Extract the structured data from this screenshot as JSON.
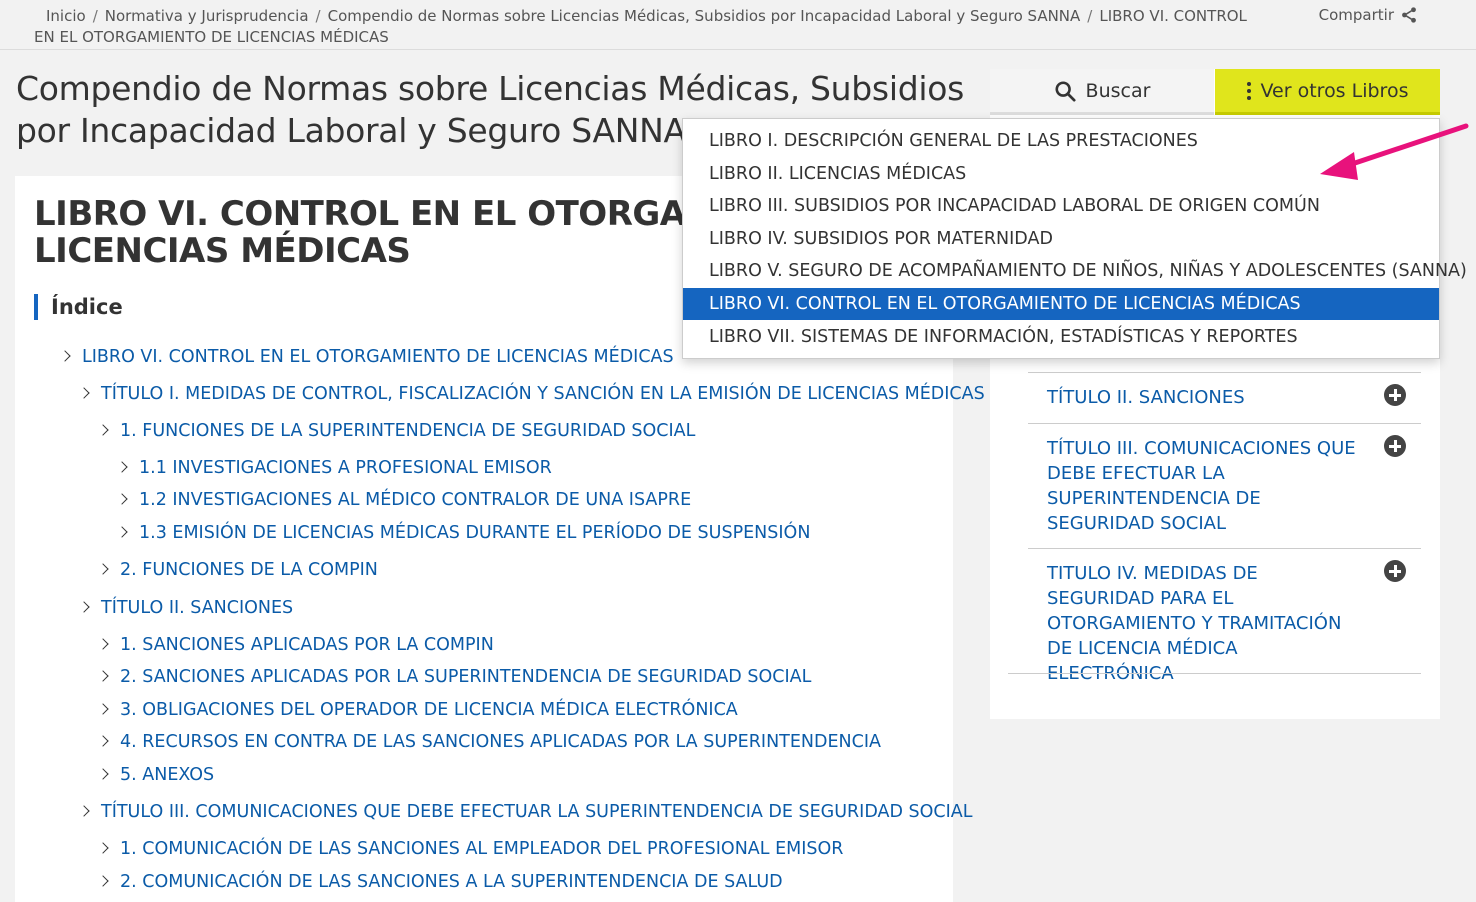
{
  "breadcrumb": {
    "items": [
      "Inicio",
      "Normativa y Jurisprudencia",
      "Compendio de Normas sobre Licencias Médicas, Subsidios por Incapacidad Laboral y Seguro SANNA",
      "LIBRO VI. CONTROL EN EL OTORGAMIENTO DE LICENCIAS MÉDICAS"
    ],
    "separator": "/"
  },
  "share": {
    "label": "Compartir",
    "icon": "share-icon"
  },
  "page_title": "Compendio de Normas sobre Licencias Médicas, Subsidios por Incapacidad Laboral y Seguro SANNA",
  "book": {
    "heading": "LIBRO VI. CONTROL EN EL OTORGAMIENTO DE LICENCIAS MÉDICAS",
    "index_label": "Índice"
  },
  "toc": [
    {
      "level": 0,
      "label": "LIBRO VI. CONTROL EN EL OTORGAMIENTO DE LICENCIAS MÉDICAS"
    },
    {
      "level": 1,
      "label": "TÍTULO I. MEDIDAS DE CONTROL, FISCALIZACIÓN Y SANCIÓN EN LA EMISIÓN DE LICENCIAS MÉDICAS"
    },
    {
      "level": 2,
      "label": "1. FUNCIONES DE LA SUPERINTENDENCIA DE SEGURIDAD SOCIAL"
    },
    {
      "level": 3,
      "label": "1.1 INVESTIGACIONES A PROFESIONAL EMISOR"
    },
    {
      "level": 3,
      "label": "1.2 INVESTIGACIONES AL MÉDICO CONTRALOR DE UNA ISAPRE"
    },
    {
      "level": 3,
      "label": "1.3 EMISIÓN DE LICENCIAS MÉDICAS DURANTE EL PERÍODO DE SUSPENSIÓN"
    },
    {
      "level": 2,
      "label": "2. FUNCIONES DE LA COMPIN"
    },
    {
      "level": 1,
      "label": "TÍTULO II. SANCIONES"
    },
    {
      "level": 2,
      "label": "1. SANCIONES APLICADAS POR LA COMPIN"
    },
    {
      "level": 2,
      "label": "2. SANCIONES APLICADAS POR LA SUPERINTENDENCIA DE SEGURIDAD SOCIAL"
    },
    {
      "level": 2,
      "label": "3. OBLIGACIONES DEL OPERADOR DE LICENCIA MÉDICA ELECTRÓNICA"
    },
    {
      "level": 2,
      "label": "4. RECURSOS EN CONTRA DE LAS SANCIONES APLICADAS POR LA SUPERINTENDENCIA"
    },
    {
      "level": 2,
      "label": "5. ANEXOS"
    },
    {
      "level": 1,
      "label": "TÍTULO III. COMUNICACIONES QUE DEBE EFECTUAR LA SUPERINTENDENCIA DE SEGURIDAD SOCIAL"
    },
    {
      "level": 2,
      "label": "1. COMUNICACIÓN DE LAS SANCIONES AL EMPLEADOR DEL PROFESIONAL EMISOR"
    },
    {
      "level": 2,
      "label": "2. COMUNICACIÓN DE LAS SANCIONES A LA SUPERINTENDENCIA DE SALUD"
    }
  ],
  "sidebar": {
    "search_label": "Buscar",
    "books_label": "Ver otros Libros",
    "items": [
      {
        "label": "TÍTULO II. SANCIONES"
      },
      {
        "label": "TÍTULO III. COMUNICACIONES QUE DEBE EFECTUAR LA SUPERINTENDENCIA DE SEGURIDAD SOCIAL"
      },
      {
        "label": "TITULO IV. MEDIDAS DE SEGURIDAD PARA EL OTORGAMIENTO Y TRAMITACIÓN DE LICENCIA MÉDICA ELECTRÓNICA"
      }
    ]
  },
  "books_dropdown": {
    "selected_index": 5,
    "items": [
      "LIBRO I. DESCRIPCIÓN GENERAL DE LAS PRESTACIONES",
      "LIBRO II. LICENCIAS MÉDICAS",
      "LIBRO III. SUBSIDIOS POR INCAPACIDAD LABORAL DE ORIGEN COMÚN",
      "LIBRO IV. SUBSIDIOS POR MATERNIDAD",
      "LIBRO V. SEGURO DE ACOMPAÑAMIENTO DE NIÑOS, NIÑAS Y ADOLESCENTES (SANNA)",
      "LIBRO VI. CONTROL EN EL OTORGAMIENTO DE LICENCIAS MÉDICAS",
      "LIBRO VII. SISTEMAS DE INFORMACIÓN, ESTADÍSTICAS Y REPORTES"
    ]
  },
  "colors": {
    "link": "#0b5ba8",
    "accent": "#1565c0",
    "books_button": "#e0e51c",
    "annotation_arrow": "#e8127c"
  }
}
